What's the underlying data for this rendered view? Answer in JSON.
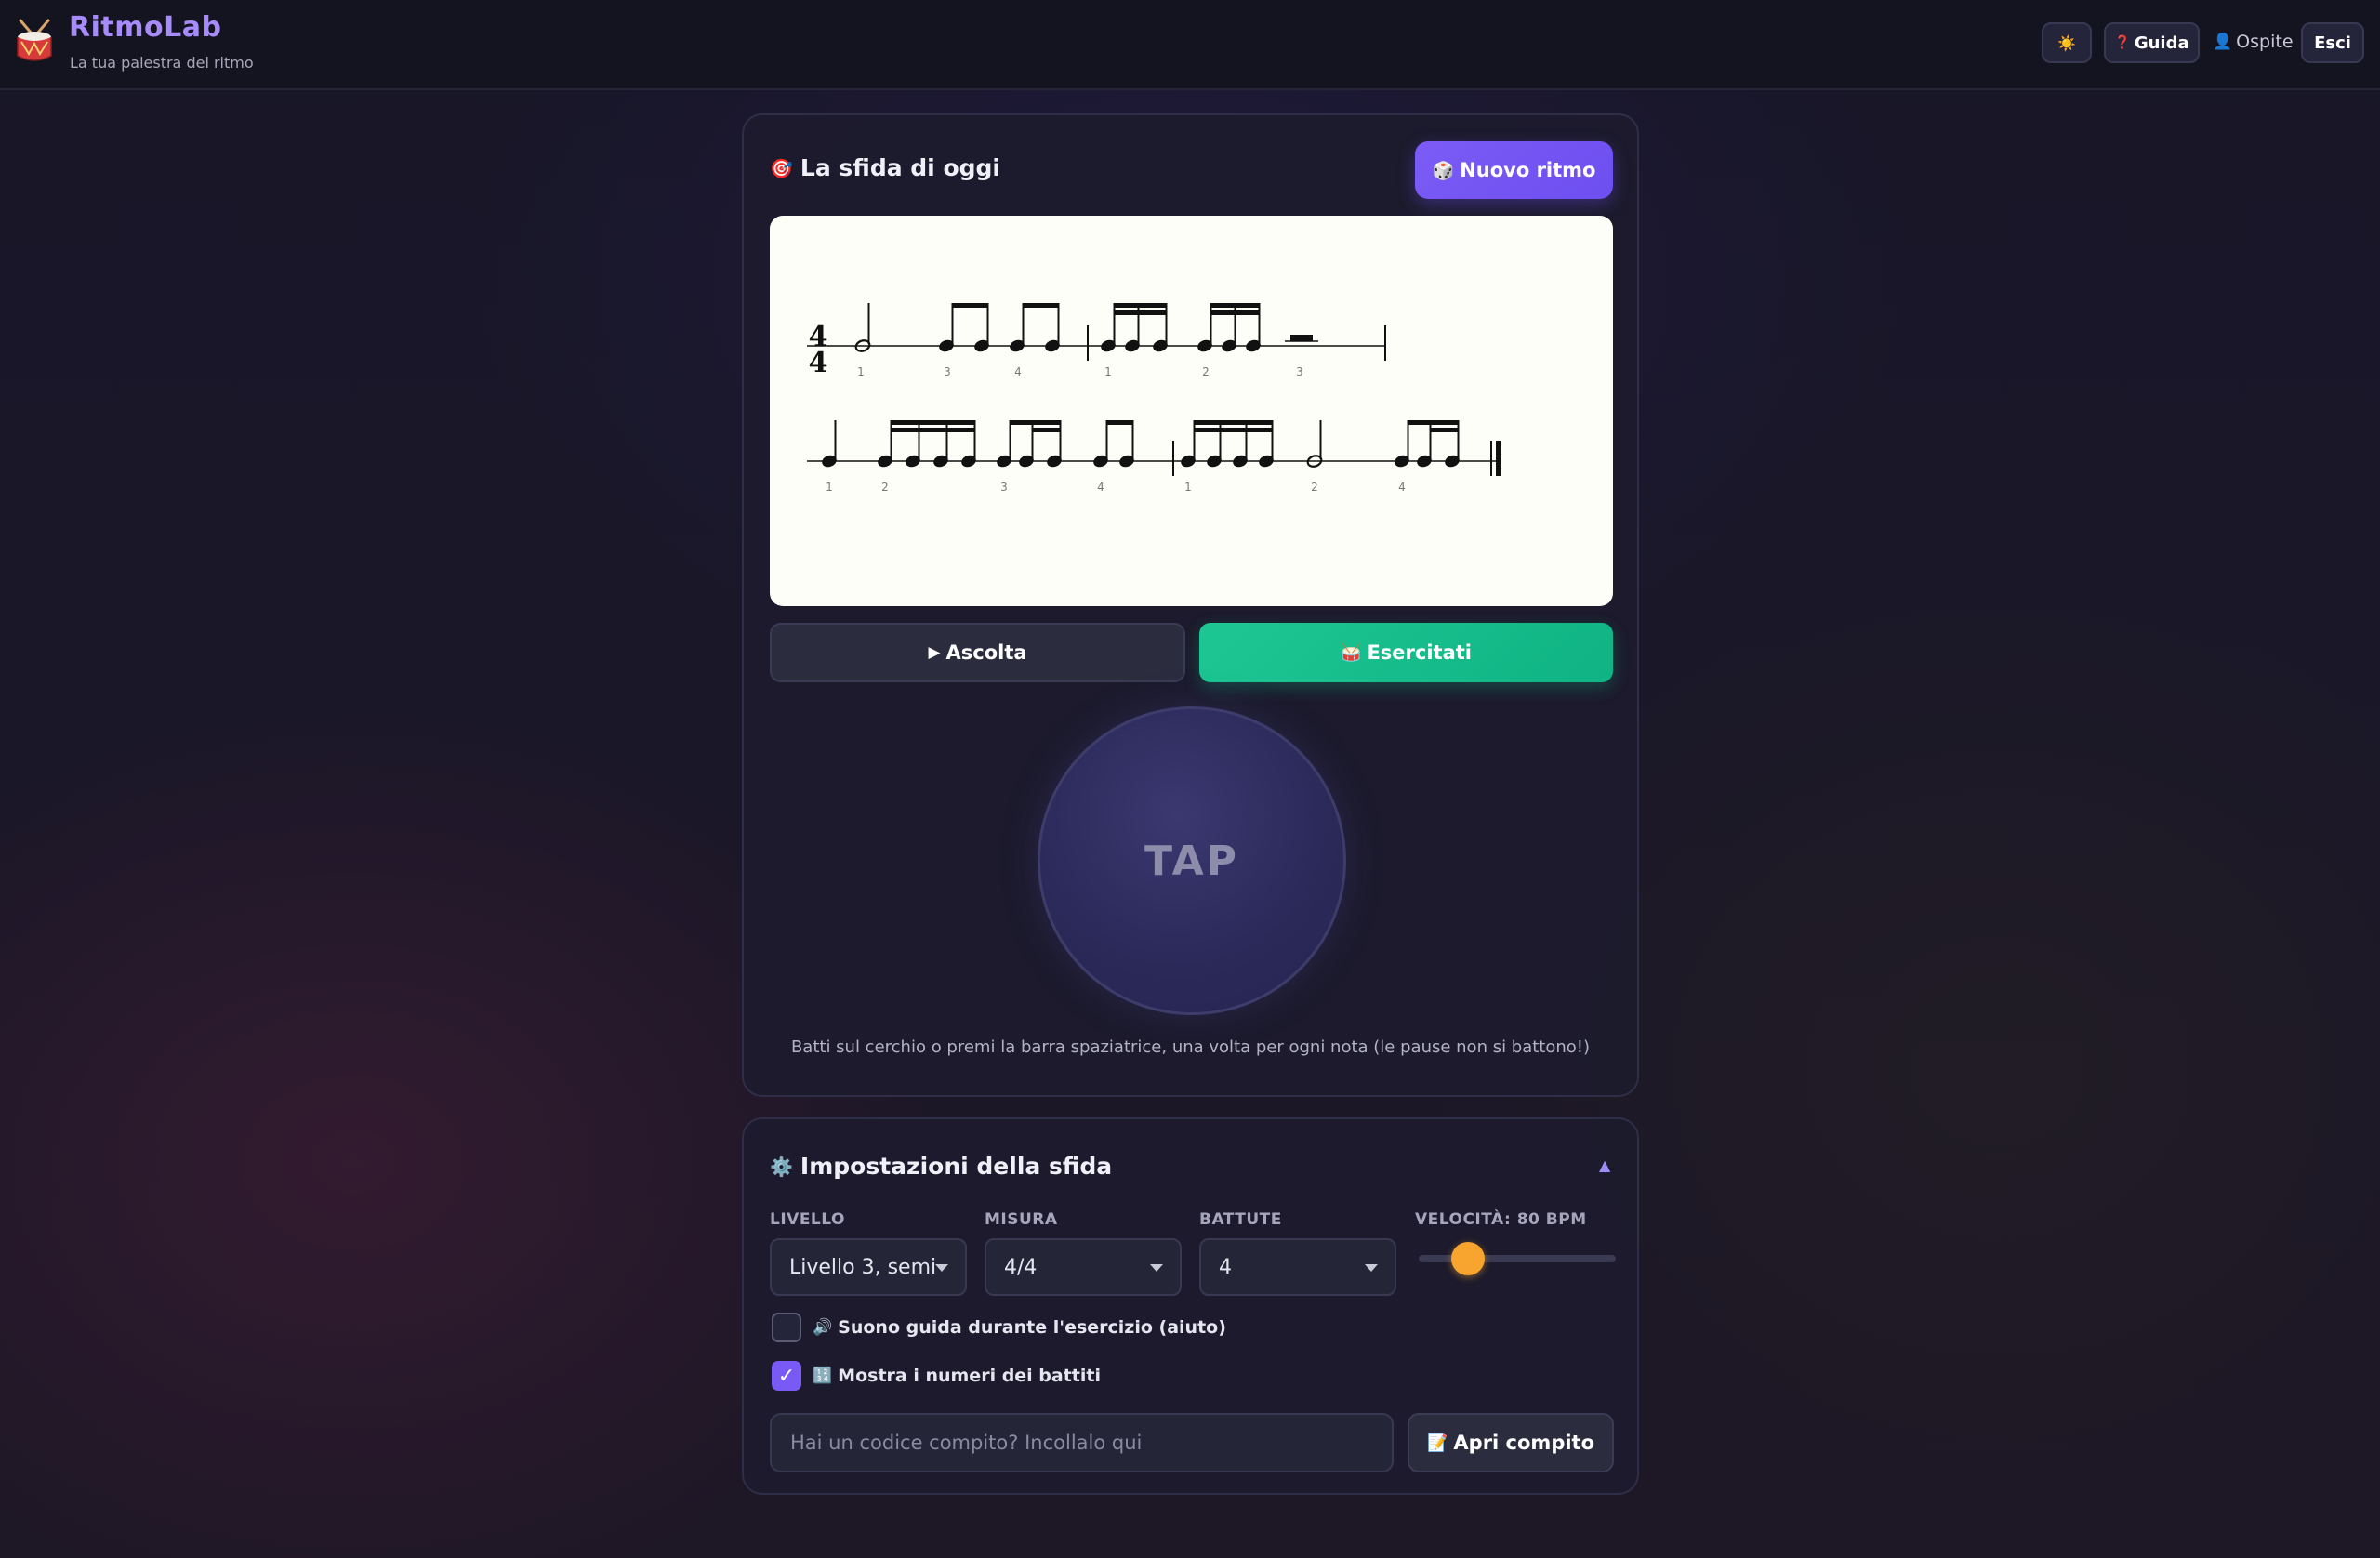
{
  "header": {
    "app_name": "RitmoLab",
    "tagline": "La tua palestra del ritmo",
    "theme_icon": "☀️",
    "guide_icon": "❓",
    "guide_label": "Guida",
    "guest_icon": "👤",
    "guest_label": "Ospite",
    "exit_label": "Esci"
  },
  "challenge": {
    "title_icon": "🎯",
    "title": "La sfida di oggi",
    "new_rhythm_icon": "🎲",
    "new_rhythm_label": "Nuovo ritmo",
    "time_signature": {
      "top": "4",
      "bottom": "4"
    },
    "beat_numbers_row1": [
      "1",
      "3",
      "4",
      "1",
      "2",
      "3"
    ],
    "beat_numbers_row2": [
      "1",
      "2",
      "3",
      "4",
      "1",
      "2",
      "4"
    ],
    "listen_icon": "▶",
    "listen_label": "Ascolta",
    "practice_icon": "🥁",
    "practice_label": "Esercitati",
    "tap_label": "TAP",
    "hint": "Batti sul cerchio o premi la barra spaziatrice, una volta per ogni nota (le pause non si battono!)"
  },
  "settings": {
    "title_icon": "⚙️",
    "title": "Impostazioni della sfida",
    "collapse_icon": "▲",
    "level_label": "LIVELLO",
    "level_value": "Livello 3, semi",
    "measure_label": "MISURA",
    "measure_value": "4/4",
    "bars_label": "BATTUTE",
    "bars_value": "4",
    "speed_label": "VELOCITÀ: 80 BPM",
    "speed_bpm": 80,
    "guide_sound_icon": "🔊",
    "guide_sound_label": "Suono guida durante l'esercizio (aiuto)",
    "guide_sound_checked": false,
    "show_numbers_icon": "🔢",
    "show_numbers_label": "Mostra i numeri dei battiti",
    "show_numbers_checked": true,
    "code_placeholder": "Hai un codice compito? Incollalo qui",
    "open_icon": "📝",
    "open_label": "Apri compito"
  },
  "colors": {
    "accent": "#7c5cf5",
    "success": "#10b383",
    "slider_thumb": "#f8a530",
    "brand_text": "#a78bfa"
  }
}
